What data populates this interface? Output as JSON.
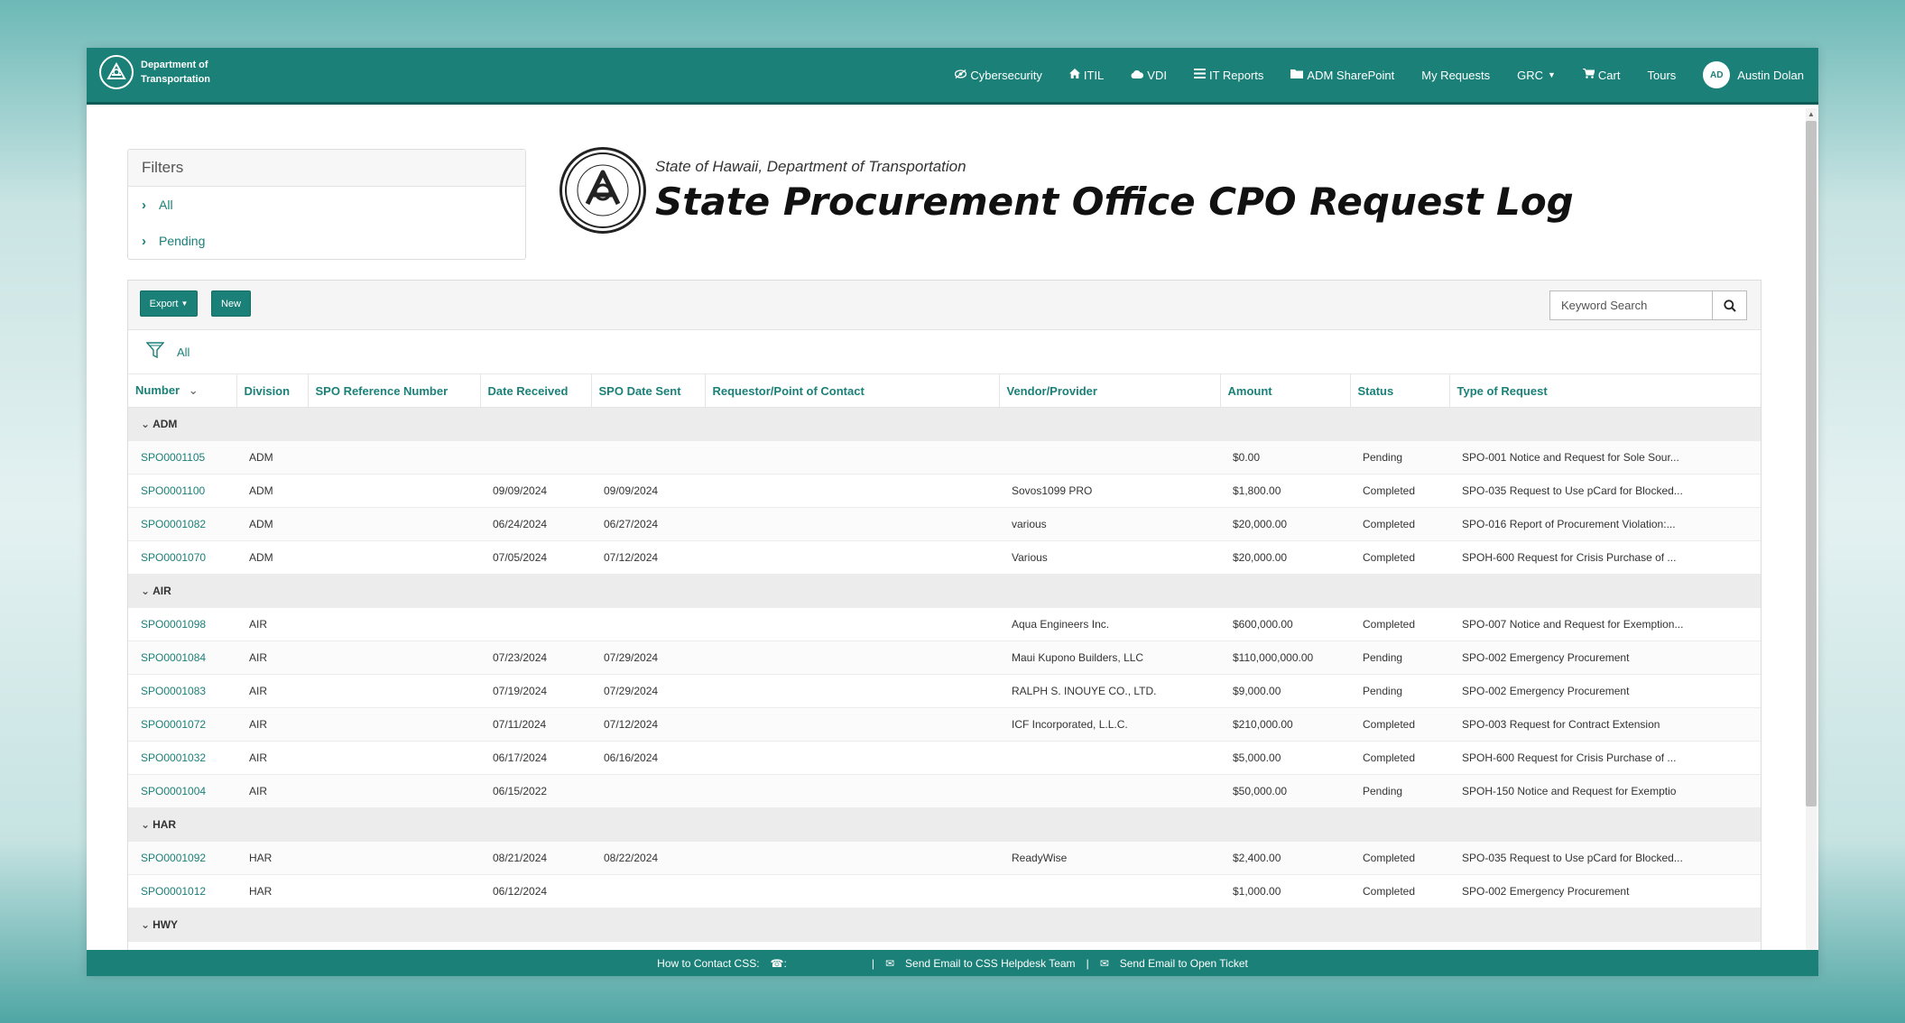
{
  "header": {
    "brand_line1": "Department of",
    "brand_line2": "Transportation",
    "nav": [
      {
        "label": "Cybersecurity",
        "icon": "eye-slash-icon"
      },
      {
        "label": "ITIL",
        "icon": "home-icon"
      },
      {
        "label": "VDI",
        "icon": "cloud-icon"
      },
      {
        "label": "IT Reports",
        "icon": "list-icon"
      },
      {
        "label": "ADM SharePoint",
        "icon": "folder-icon"
      },
      {
        "label": "My Requests"
      },
      {
        "label": "GRC"
      },
      {
        "label": "Cart",
        "icon": "cart-icon"
      },
      {
        "label": "Tours"
      }
    ],
    "user_initials": "AD",
    "user_name": "Austin Dolan"
  },
  "filters": {
    "title": "Filters",
    "items": [
      "All",
      "Pending"
    ]
  },
  "page_title": {
    "subtitle": "State of Hawaii, Department of Transportation",
    "title": "State Procurement Office CPO Request Log"
  },
  "toolbar": {
    "export_label": "Export",
    "new_label": "New",
    "search_placeholder": "Keyword Search"
  },
  "active_filter": "All",
  "table": {
    "columns": [
      "Number",
      "Division",
      "SPO Reference Number",
      "Date Received",
      "SPO Date Sent",
      "Requestor/Point of Contact",
      "Vendor/Provider",
      "Amount",
      "Status",
      "Type of Request"
    ],
    "groups": [
      {
        "name": "ADM",
        "rows": [
          {
            "number": "SPO0001105",
            "division": "ADM",
            "spo_ref": "",
            "date_received": "",
            "date_sent": "",
            "requestor": "",
            "vendor": "",
            "amount": "$0.00",
            "status": "Pending",
            "type": "SPO-001 Notice and Request for Sole Sour..."
          },
          {
            "number": "SPO0001100",
            "division": "ADM",
            "spo_ref": "",
            "date_received": "09/09/2024",
            "date_sent": "09/09/2024",
            "requestor": "",
            "vendor": "Sovos1099 PRO",
            "amount": "$1,800.00",
            "status": "Completed",
            "type": "SPO-035 Request to Use pCard for Blocked..."
          },
          {
            "number": "SPO0001082",
            "division": "ADM",
            "spo_ref": "",
            "date_received": "06/24/2024",
            "date_sent": "06/27/2024",
            "requestor": "",
            "vendor": "various",
            "amount": "$20,000.00",
            "status": "Completed",
            "type": "SPO-016 Report of Procurement Violation:..."
          },
          {
            "number": "SPO0001070",
            "division": "ADM",
            "spo_ref": "",
            "date_received": "07/05/2024",
            "date_sent": "07/12/2024",
            "requestor": "",
            "vendor": "Various",
            "amount": "$20,000.00",
            "status": "Completed",
            "type": "SPOH-600 Request for Crisis Purchase of ..."
          }
        ]
      },
      {
        "name": "AIR",
        "rows": [
          {
            "number": "SPO0001098",
            "division": "AIR",
            "spo_ref": "",
            "date_received": "",
            "date_sent": "",
            "requestor": "",
            "vendor": "Aqua Engineers Inc.",
            "amount": "$600,000.00",
            "status": "Completed",
            "type": "SPO-007 Notice and Request for Exemption..."
          },
          {
            "number": "SPO0001084",
            "division": "AIR",
            "spo_ref": "",
            "date_received": "07/23/2024",
            "date_sent": "07/29/2024",
            "requestor": "",
            "vendor": "Maui Kupono Builders, LLC",
            "amount": "$110,000,000.00",
            "status": "Pending",
            "type": "SPO-002 Emergency Procurement"
          },
          {
            "number": "SPO0001083",
            "division": "AIR",
            "spo_ref": "",
            "date_received": "07/19/2024",
            "date_sent": "07/29/2024",
            "requestor": "",
            "vendor": "RALPH S. INOUYE CO., LTD.",
            "amount": "$9,000.00",
            "status": "Pending",
            "type": "SPO-002 Emergency Procurement"
          },
          {
            "number": "SPO0001072",
            "division": "AIR",
            "spo_ref": "",
            "date_received": "07/11/2024",
            "date_sent": "07/12/2024",
            "requestor": "",
            "vendor": "ICF Incorporated, L.L.C.",
            "amount": "$210,000.00",
            "status": "Completed",
            "type": "SPO-003 Request for Contract Extension"
          },
          {
            "number": "SPO0001032",
            "division": "AIR",
            "spo_ref": "",
            "date_received": "06/17/2024",
            "date_sent": "06/16/2024",
            "requestor": "",
            "vendor": "",
            "amount": "$5,000.00",
            "status": "Completed",
            "type": "SPOH-600 Request for Crisis Purchase of ..."
          },
          {
            "number": "SPO0001004",
            "division": "AIR",
            "spo_ref": "",
            "date_received": "06/15/2022",
            "date_sent": "",
            "requestor": "",
            "vendor": "",
            "amount": "$50,000.00",
            "status": "Pending",
            "type": "SPOH-150 Notice and Request for Exemptio"
          }
        ]
      },
      {
        "name": "HAR",
        "rows": [
          {
            "number": "SPO0001092",
            "division": "HAR",
            "spo_ref": "",
            "date_received": "08/21/2024",
            "date_sent": "08/22/2024",
            "requestor": "",
            "vendor": "ReadyWise",
            "amount": "$2,400.00",
            "status": "Completed",
            "type": "SPO-035 Request to Use pCard for Blocked..."
          },
          {
            "number": "SPO0001012",
            "division": "HAR",
            "spo_ref": "",
            "date_received": "06/12/2024",
            "date_sent": "",
            "requestor": "",
            "vendor": "",
            "amount": "$1,000.00",
            "status": "Completed",
            "type": "SPO-002 Emergency Procurement"
          }
        ]
      },
      {
        "name": "HWY",
        "rows": []
      }
    ]
  },
  "footer": {
    "contact": "How to Contact CSS:",
    "helpdesk_email": "Send Email to CSS Helpdesk Team",
    "ticket_email": "Send Email to Open Ticket"
  },
  "colors": {
    "primary": "#1b8078",
    "footer": "#1b8078"
  }
}
